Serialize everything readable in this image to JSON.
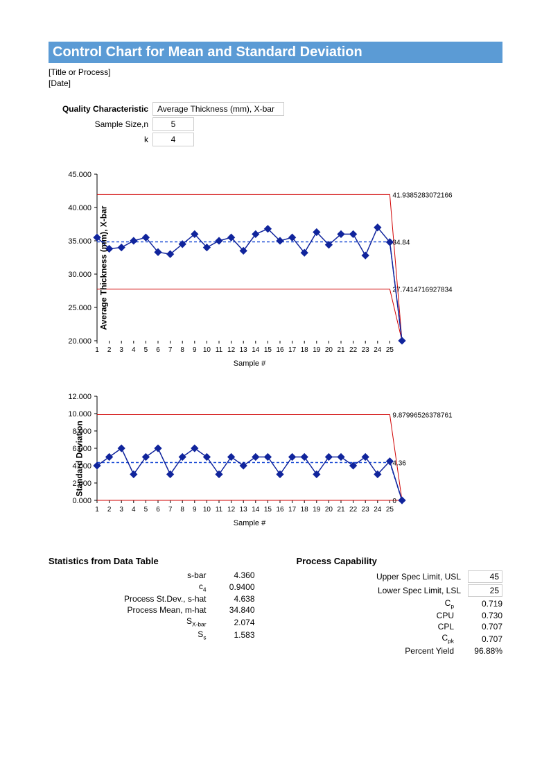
{
  "banner": "Control Chart for Mean and Standard Deviation",
  "meta": {
    "title": "[Title or Process]",
    "date": "[Date]"
  },
  "params": {
    "qc_label": "Quality Characteristic",
    "qc_value": "Average Thickness (mm), X-bar",
    "ss_label": "Sample Size,n",
    "ss_value": "5",
    "k_label": "k",
    "k_value": "4"
  },
  "chart_data": [
    {
      "type": "line",
      "title": "",
      "xlabel": "Sample #",
      "ylabel": "Average Thickness (mm), X-bar",
      "ylim": [
        20,
        45
      ],
      "yticks": [
        20,
        25,
        30,
        35,
        40,
        45
      ],
      "ucl": 41.9385283072166,
      "cl": 34.84,
      "lcl": 27.7414716927834,
      "ucl_label": "41.9385283072166",
      "cl_label": "34.84",
      "lcl_label": "27.7414716927834",
      "x": [
        1,
        2,
        3,
        4,
        5,
        6,
        7,
        8,
        9,
        10,
        11,
        12,
        13,
        14,
        15,
        16,
        17,
        18,
        19,
        20,
        21,
        22,
        23,
        24,
        25
      ],
      "y": [
        35.5,
        33.8,
        34.0,
        35.0,
        35.5,
        33.3,
        33.0,
        34.5,
        36.0,
        34.0,
        35.0,
        35.5,
        33.5,
        36.0,
        36.8,
        35.0,
        35.5,
        33.2,
        36.3,
        34.4,
        36.0,
        36.0,
        32.8,
        37.0,
        34.8
      ]
    },
    {
      "type": "line",
      "title": "",
      "xlabel": "Sample #",
      "ylabel": "Standard Deviation",
      "ylim": [
        0,
        12
      ],
      "yticks": [
        0,
        2,
        4,
        6,
        8,
        10,
        12
      ],
      "ucl": 9.87996526378761,
      "cl": 4.36,
      "lcl": 0,
      "ucl_label": "9.87996526378761",
      "cl_label": "4.36",
      "lcl_label": "0",
      "x": [
        1,
        2,
        3,
        4,
        5,
        6,
        7,
        8,
        9,
        10,
        11,
        12,
        13,
        14,
        15,
        16,
        17,
        18,
        19,
        20,
        21,
        22,
        23,
        24,
        25
      ],
      "y": [
        4.0,
        5.0,
        6.0,
        3.0,
        5.0,
        6.0,
        3.0,
        5.0,
        6.0,
        5.0,
        3.0,
        5.0,
        4.0,
        5.0,
        5.0,
        3.0,
        5.0,
        5.0,
        3.0,
        5.0,
        5.0,
        4.0,
        5.0,
        3.0,
        4.5
      ]
    }
  ],
  "stats_hdr": "Statistics from Data Table",
  "stats": {
    "sbar_l": "s-bar",
    "sbar_v": "4.360",
    "c4_l": "c4",
    "c4_v": "0.9400",
    "shat_l": "Process St.Dev., s-hat",
    "shat_v": "4.638",
    "mhat_l": "Process Mean, m-hat",
    "mhat_v": "34.840",
    "sxbar_l": "SX-bar",
    "sxbar_v": "2.074",
    "ss_l": "Ss",
    "ss_v": "1.583"
  },
  "cap_hdr": "Process Capability",
  "cap": {
    "usl_l": "Upper Spec Limit, USL",
    "usl_v": "45",
    "lsl_l": "Lower Spec Limit, LSL",
    "lsl_v": "25",
    "cp_l": "Cp",
    "cp_v": "0.719",
    "cpu_l": "CPU",
    "cpu_v": "0.730",
    "cpl_l": "CPL",
    "cpl_v": "0.707",
    "cpk_l": "Cpk",
    "cpk_v": "0.707",
    "py_l": "Percent Yield",
    "py_v": "96.88%"
  }
}
